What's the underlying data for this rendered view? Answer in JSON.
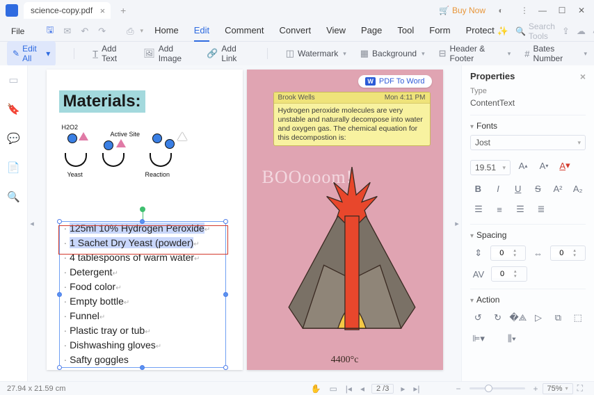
{
  "titlebar": {
    "tab_name": "science-copy.pdf",
    "buy_now": "Buy Now"
  },
  "menubar": {
    "file": "File",
    "tabs": [
      "Home",
      "Edit",
      "Comment",
      "Convert",
      "View",
      "Page",
      "Tool",
      "Form",
      "Protect"
    ],
    "active_tab": "Edit",
    "search_placeholder": "Search Tools"
  },
  "toolbar": {
    "edit_all": "Edit All",
    "add_text": "Add Text",
    "add_image": "Add Image",
    "add_link": "Add Link",
    "watermark": "Watermark",
    "background": "Background",
    "header_footer": "Header & Footer",
    "bates": "Bates Number"
  },
  "doc": {
    "materials_heading": "Materials:",
    "diagram_h2o2": "H2O2",
    "diagram_active": "Active Site",
    "diagram_yeast": "Yeast",
    "diagram_reaction": "Reaction",
    "list": [
      "125ml 10% Hydrogen Peroxide",
      "1 Sachet Dry Yeast (powder)",
      "4 tablespoons of warm water",
      "Detergent",
      "Food color",
      "Empty bottle",
      "Funnel",
      "Plastic tray or tub",
      "Dishwashing gloves",
      "Safty goggles"
    ],
    "pdf_to_word": "PDF To Word",
    "note_author": "Brook Wells",
    "note_time": "Mon 4:11 PM",
    "note_body": "Hydrogen peroxide molecules are very unstable and naturally decompose into water and oxygen gas. The chemical equation for this decompostion is:",
    "boom": "BOOooom!",
    "temp": "4400°c"
  },
  "props": {
    "title": "Properties",
    "type_label": "Type",
    "type_value": "ContentText",
    "fonts_label": "Fonts",
    "font_family": "Jost",
    "font_size": "19.51",
    "spacing_label": "Spacing",
    "spacing_para": "0",
    "spacing_char": "0",
    "spacing_line": "0",
    "action_label": "Action"
  },
  "status": {
    "dims": "27.94 x 21.59 cm",
    "page_current": "2",
    "page_total": "3",
    "zoom": "75%"
  }
}
